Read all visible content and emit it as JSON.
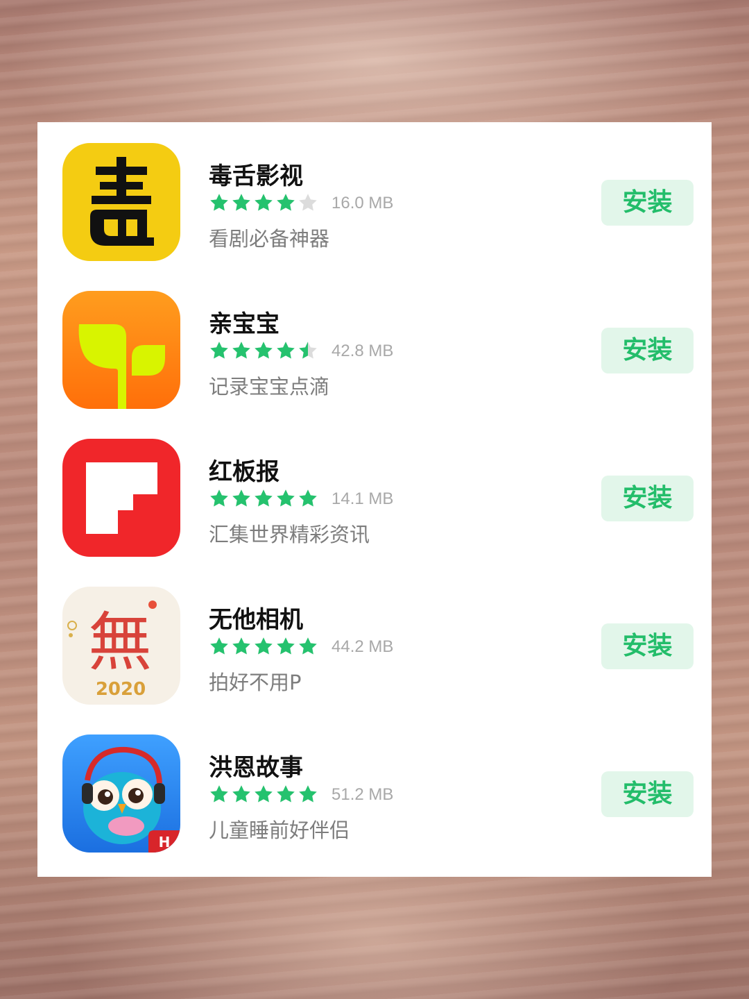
{
  "colors": {
    "star_filled": "#25c26e",
    "star_empty": "#dcdcdc",
    "install_text": "#23bd6a",
    "install_bg": "#e2f6ea"
  },
  "apps": [
    {
      "name": "毒舌影视",
      "rating": 4,
      "size": "16.0 MB",
      "description": "看剧必备神器",
      "install_label": "安装",
      "icon": "dushe-icon"
    },
    {
      "name": "亲宝宝",
      "rating": 4.5,
      "size": "42.8 MB",
      "description": "记录宝宝点滴",
      "install_label": "安装",
      "icon": "sprout-icon"
    },
    {
      "name": "红板报",
      "rating": 5,
      "size": "14.1 MB",
      "description": "汇集世界精彩资讯",
      "install_label": "安装",
      "icon": "flipboard-icon"
    },
    {
      "name": "无他相机",
      "rating": 5,
      "size": "44.2 MB",
      "description": "拍好不用P",
      "install_label": "安装",
      "icon": "wu-2020-icon",
      "icon_text": "無",
      "icon_year": "2020"
    },
    {
      "name": "洪恩故事",
      "rating": 5,
      "size": "51.2 MB",
      "description": "儿童睡前好伴侣",
      "install_label": "安装",
      "icon": "owl-headphones-icon",
      "icon_badge": "H"
    }
  ]
}
